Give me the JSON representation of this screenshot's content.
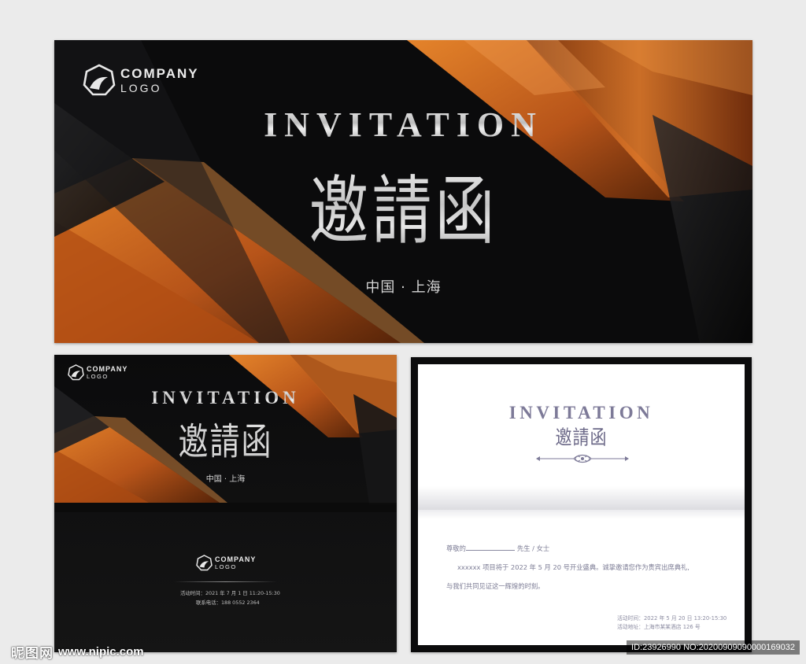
{
  "cover_large": {
    "logo_line1": "COMPANY",
    "logo_line2": "LOGO",
    "title_en": "INVITATION",
    "title_cn": "邀請函",
    "location": "中国 · 上海"
  },
  "cover_small": {
    "logo_line1": "COMPANY",
    "logo_line2": "LOGO",
    "title_en": "INVITATION",
    "title_cn": "邀請函",
    "location": "中国 · 上海",
    "back_logo_line1": "COMPANY",
    "back_logo_line2": "LOGO",
    "activity_time": "活动时间：2021 年 7 月 1 日 11:20-15:30",
    "contact_phone": "联系电话：188 0552 2364"
  },
  "inner_page": {
    "title_en": "INVITATION",
    "title_cn": "邀請函",
    "greeting_prefix": "尊敬的",
    "greeting_suffix": "先生 / 女士",
    "paragraph_1": "xxxxxx 项目将于 2022 年 5 月 20 号开业盛典。诚挚邀请您作为贵宾出席典礼,",
    "paragraph_2": "与我们共同见证这一辉煌的时刻。",
    "event_time": "活动时间：2022 年 5 月 20 日 13:20-15:30",
    "event_address": "活动地址：上海市某某酒店 126 号"
  },
  "watermark": {
    "brand": "昵图网",
    "url": "www.nipic.com",
    "id_text": "ID:23926990 NO:20200909090000169032"
  },
  "colors": {
    "background": "#0b0b0c",
    "accent_orange": "#d9701e",
    "silver": "#c8c8c8",
    "inner_text": "#7d7a98"
  },
  "icons": [
    "company-logo-icon",
    "ornament-divider-icon"
  ]
}
